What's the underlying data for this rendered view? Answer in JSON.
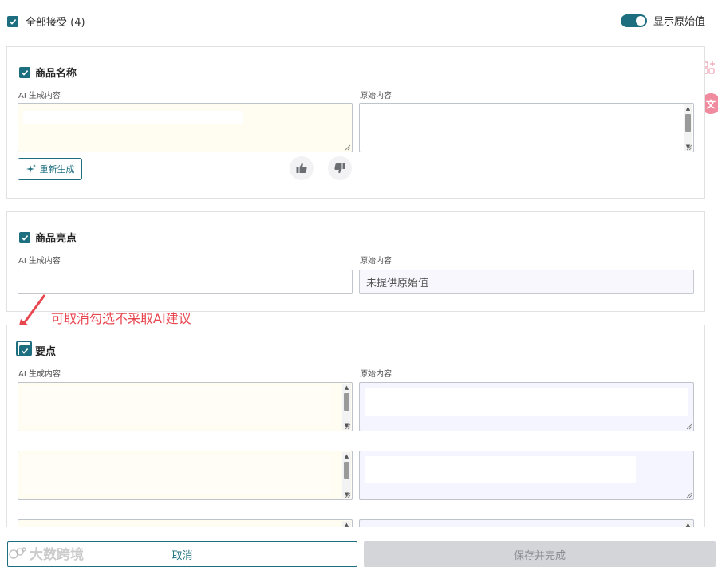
{
  "header": {
    "accept_all_label": "全部接受 (4)",
    "toggle_label": "显示原始值",
    "toggle_on": true
  },
  "labels": {
    "ai_content": "AI 生成内容",
    "original_content": "原始内容"
  },
  "sections": {
    "name": {
      "title": "商品名称",
      "regenerate_label": "重新生成"
    },
    "highlight": {
      "title": "商品亮点",
      "original_placeholder": "未提供原始值"
    },
    "keypoints": {
      "title": "要点"
    }
  },
  "annotation": {
    "text": "可取消勾选不采取AI建议"
  },
  "footer": {
    "cancel_label": "取消",
    "save_label": "保存并完成",
    "watermark": "大数跨境"
  },
  "colors": {
    "accent": "#1d6f80",
    "annotation_red": "#e8464f",
    "ai_bg": "#fffcf1",
    "original_bg": "#f5f5ff"
  },
  "icons": [
    "check-icon",
    "toggle-icon",
    "sparkle-icon",
    "thumbs-up-icon",
    "thumbs-down-icon",
    "arrow-icon",
    "apps-icon",
    "translate-icon"
  ]
}
